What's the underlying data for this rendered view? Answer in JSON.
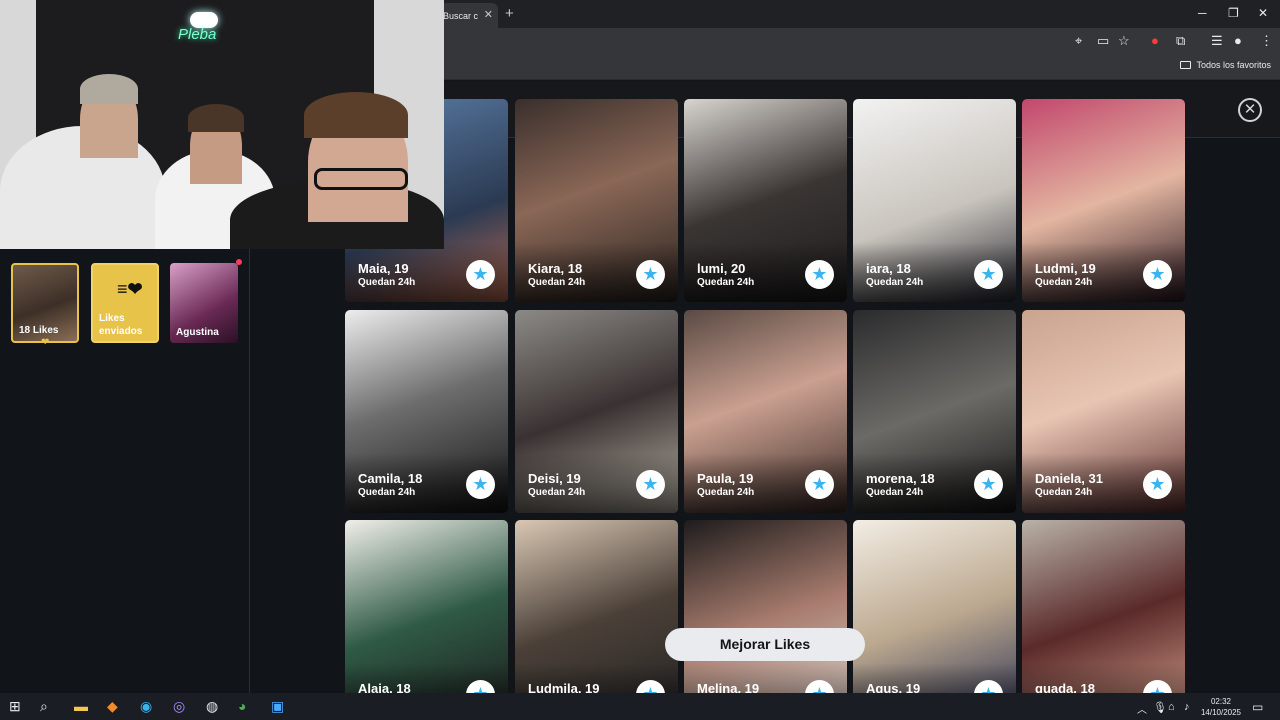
{
  "browser": {
    "tab_title": "Buscar c",
    "bookmarks_folder": "Todos los favoritos"
  },
  "sidebar": {
    "likes_card_label": "18 Likes",
    "sent_card_label_1": "Likes",
    "sent_card_label_2": "enviados",
    "match_name": "Agustina"
  },
  "profiles": [
    {
      "name": "Maia, 19",
      "time": "Quedan 24h"
    },
    {
      "name": "Kiara, 18",
      "time": "Quedan 24h"
    },
    {
      "name": "lumi, 20",
      "time": "Quedan 24h"
    },
    {
      "name": "iara, 18",
      "time": "Quedan 24h"
    },
    {
      "name": "Ludmi, 19",
      "time": "Quedan 24h"
    },
    {
      "name": "Camila, 18",
      "time": "Quedan 24h"
    },
    {
      "name": "Deisi, 19",
      "time": "Quedan 24h"
    },
    {
      "name": "Paula, 19",
      "time": "Quedan 24h"
    },
    {
      "name": "morena, 18",
      "time": "Quedan 24h"
    },
    {
      "name": "Daniela, 31",
      "time": "Quedan 24h"
    },
    {
      "name": "Alaia, 18"
    },
    {
      "name": "Ludmila, 19"
    },
    {
      "name": "Melina, 19"
    },
    {
      "name": "Agus, 19"
    },
    {
      "name": "guada, 18"
    }
  ],
  "upgrade_button": "Mejorar Likes",
  "webcam": {
    "neon_sign": "Pleba"
  },
  "taskbar": {
    "time": "02:32",
    "date": "14/10/2025"
  },
  "icons": [
    "close-icon",
    "star-icon",
    "heart-icon",
    "folder-icon",
    "windows-icon",
    "search-icon"
  ]
}
